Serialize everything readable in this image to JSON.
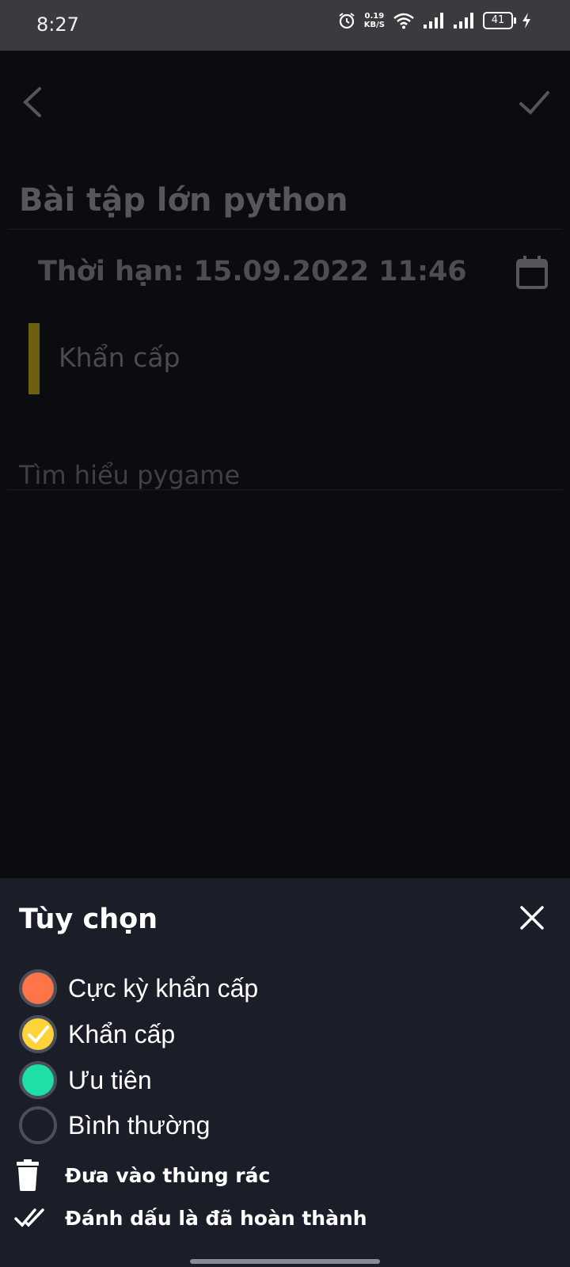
{
  "status_bar": {
    "time": "8:27",
    "net_speed_value": "0.19",
    "net_speed_unit": "KB/S",
    "battery_level": "41",
    "icons": [
      "alarm-icon",
      "wifi-icon",
      "signal-icon",
      "signal-icon",
      "battery-icon",
      "charging-icon"
    ]
  },
  "editor": {
    "title": "Bài tập lớn python",
    "deadline": "Thời hạn: 15.09.2022 11:46",
    "priority_label": "Khẩn cấp",
    "priority_color": "#6e5f10",
    "note": "Tìm hiểu pygame"
  },
  "sheet": {
    "title": "Tùy chọn",
    "options": [
      {
        "label": "Cực kỳ khẩn cấp",
        "color": "#ff7547",
        "selected": false
      },
      {
        "label": "Khẩn cấp",
        "color": "#ffd43b",
        "selected": true
      },
      {
        "label": "Ưu tiên",
        "color": "#20dfa6",
        "selected": false
      },
      {
        "label": "Bình thường",
        "color": "#1b1e29",
        "selected": false
      }
    ],
    "actions": [
      {
        "label": "Đưa vào thùng rác",
        "icon": "trash-icon"
      },
      {
        "label": "Đánh dấu là đã hoàn thành",
        "icon": "double-check-icon"
      }
    ]
  },
  "colors": {
    "background": "#0b0c10",
    "sheet_background": "#1b1e29",
    "status_bar": "#3a3b3e"
  }
}
